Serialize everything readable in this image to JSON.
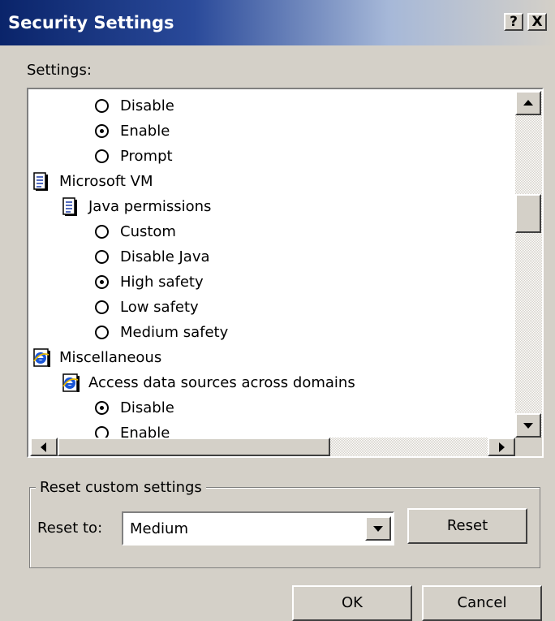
{
  "window": {
    "title": "Security Settings",
    "help_label": "?",
    "close_label": "X"
  },
  "settings_label": "Settings:",
  "tree": [
    {
      "type": "radio",
      "label": "Disable",
      "checked": false,
      "level": 2
    },
    {
      "type": "radio",
      "label": "Enable",
      "checked": true,
      "level": 2
    },
    {
      "type": "radio",
      "label": "Prompt",
      "checked": false,
      "level": 2
    },
    {
      "type": "doc",
      "label": "Microsoft VM",
      "level": 0
    },
    {
      "type": "doc",
      "label": "Java permissions",
      "level": 1
    },
    {
      "type": "radio",
      "label": "Custom",
      "checked": false,
      "level": 2
    },
    {
      "type": "radio",
      "label": "Disable Java",
      "checked": false,
      "level": 2
    },
    {
      "type": "radio",
      "label": "High safety",
      "checked": true,
      "level": 2
    },
    {
      "type": "radio",
      "label": "Low safety",
      "checked": false,
      "level": 2
    },
    {
      "type": "radio",
      "label": "Medium safety",
      "checked": false,
      "level": 2
    },
    {
      "type": "ie",
      "label": "Miscellaneous",
      "level": 0
    },
    {
      "type": "ie",
      "label": "Access data sources across domains",
      "level": 1
    },
    {
      "type": "radio",
      "label": "Disable",
      "checked": true,
      "level": 2
    },
    {
      "type": "radio",
      "label": "Enable",
      "checked": false,
      "level": 2
    }
  ],
  "reset_group": {
    "title": "Reset custom settings",
    "reset_to_label": "Reset to:",
    "selected": "Medium",
    "reset_button": "Reset"
  },
  "buttons": {
    "ok": "OK",
    "cancel": "Cancel"
  }
}
